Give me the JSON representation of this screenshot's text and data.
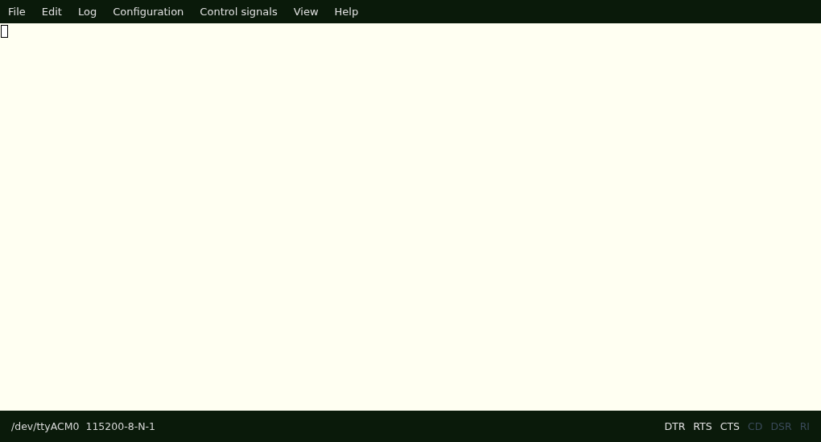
{
  "menu": [
    "File",
    "Edit",
    "Log",
    "Configuration",
    "Control signals",
    "View",
    "Help"
  ],
  "terminal": {
    "cursor": true
  },
  "status_bar": {
    "port": "/dev/ttyACM0",
    "settings": "115200-8-N-1",
    "signals": [
      {
        "label": "DTR",
        "on": true
      },
      {
        "label": "RTS",
        "on": true
      },
      {
        "label": "CTS",
        "on": true
      },
      {
        "label": "CD",
        "on": false
      },
      {
        "label": "DSR",
        "on": false
      },
      {
        "label": "RI",
        "on": false
      }
    ]
  }
}
